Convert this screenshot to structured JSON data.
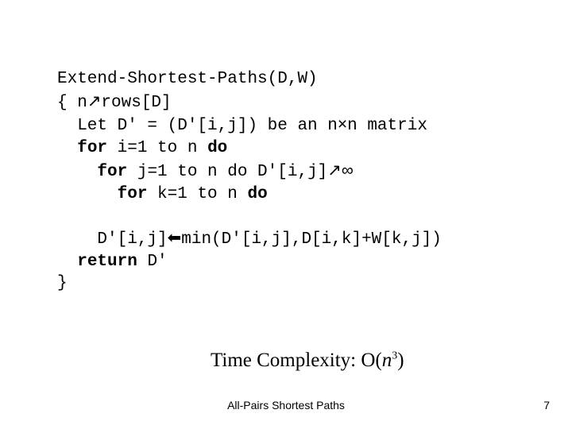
{
  "code": {
    "l1": "Extend-Shortest-Paths(D,W)",
    "l2a": "{ n",
    "l2b": "rows[D]",
    "l3a": "  Let D' = (D'[i,j]) be an n",
    "l3b": "n matrix",
    "kw_for": "for",
    "kw_do": "do",
    "l4mid": " i=1 to n ",
    "l5mid": " j=1 to n do D'[i,j]",
    "inf": "∞",
    "l6mid": " k=1 to n ",
    "l7a": "    D'[i,j]",
    "l7b": "min(D'[i,j],D[i,k]+W[k,j])",
    "ret": "return",
    "retD": " D'",
    "close": "}"
  },
  "symbols": {
    "assign": "↗",
    "times": "×",
    "larrow": "⬅"
  },
  "complexity": {
    "prefix": "Time Complexity: O(",
    "var": "n",
    "exp": "3",
    "suffix": ")"
  },
  "footer": "All-Pairs Shortest Paths",
  "page": "7"
}
